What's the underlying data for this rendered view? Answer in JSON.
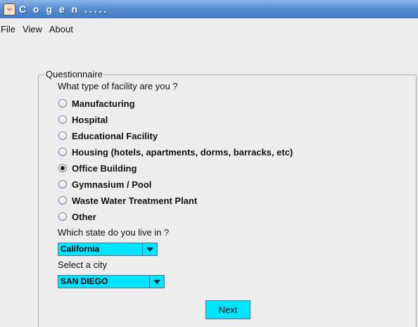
{
  "window": {
    "title": "C o g e n .....",
    "icon": "java-cup-icon"
  },
  "menubar": {
    "items": [
      "File",
      "View",
      "About"
    ]
  },
  "questionnaire": {
    "group_title": "Questionnaire",
    "facility_question": "What type of facility are you ?",
    "facility_options": [
      {
        "label": "Manufacturing",
        "selected": false
      },
      {
        "label": "Hospital",
        "selected": false
      },
      {
        "label": "Educational Facility",
        "selected": false
      },
      {
        "label": "Housing (hotels, apartments, dorms, barracks, etc)",
        "selected": false
      },
      {
        "label": "Office Building",
        "selected": true
      },
      {
        "label": "Gymnasium / Pool",
        "selected": false
      },
      {
        "label": "Waste Water Treatment Plant",
        "selected": false
      },
      {
        "label": "Other",
        "selected": false
      }
    ],
    "state_question": "Which state do you live in ?",
    "state_value": "California",
    "city_question": "Select a city",
    "city_value": "SAN DIEGO",
    "next_label": "Next"
  },
  "colors": {
    "accent_cyan": "#00e5ff",
    "titlebar_blue": "#4f86cc",
    "panel_gray": "#ededed"
  }
}
